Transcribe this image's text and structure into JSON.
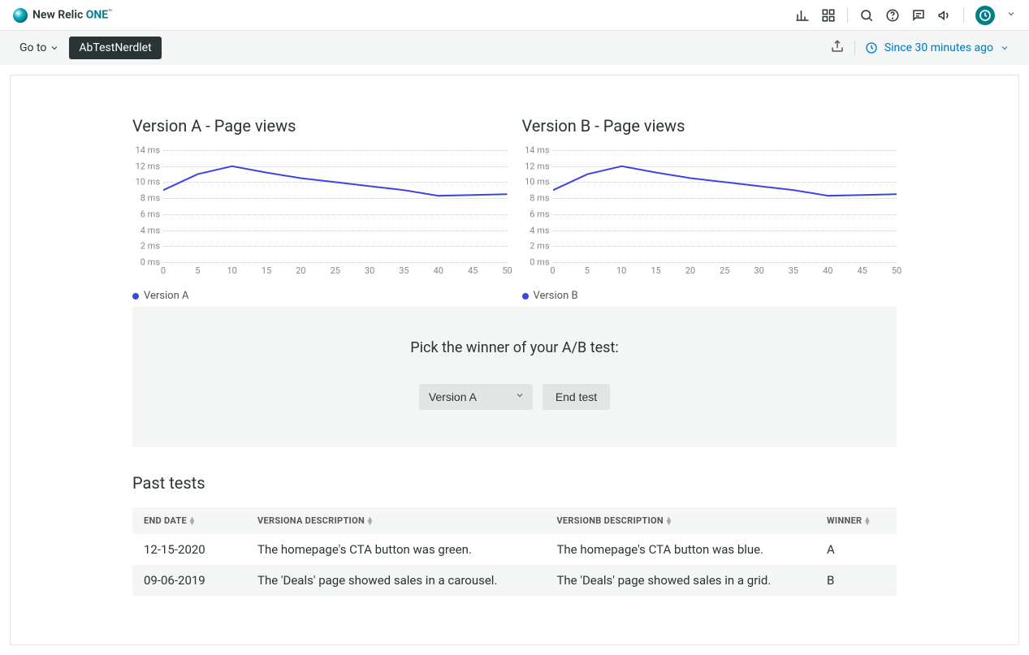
{
  "brand": {
    "name": "New Relic",
    "suffix": "ONE",
    "tm": "™"
  },
  "subheader": {
    "goto": "Go to",
    "chip": "AbTestNerdlet",
    "time": "Since 30 minutes ago"
  },
  "charts": {
    "a": {
      "title": "Version A - Page views",
      "legend": "Version A"
    },
    "b": {
      "title": "Version B - Page views",
      "legend": "Version B"
    }
  },
  "chart_data": [
    {
      "type": "line",
      "title": "Version A - Page views",
      "xlabel": "",
      "ylabel": "",
      "x": [
        0,
        5,
        10,
        15,
        20,
        25,
        30,
        35,
        40,
        45,
        50
      ],
      "y_ticks": [
        "0 ms",
        "2 ms",
        "4 ms",
        "6 ms",
        "8 ms",
        "10 ms",
        "12 ms",
        "14 ms"
      ],
      "ylim": [
        0,
        14
      ],
      "series": [
        {
          "name": "Version A",
          "values": [
            9,
            11,
            12,
            11.2,
            10.5,
            10,
            9.5,
            9,
            8.3,
            8.4,
            8.5
          ],
          "color": "#3b46e0"
        }
      ]
    },
    {
      "type": "line",
      "title": "Version B - Page views",
      "xlabel": "",
      "ylabel": "",
      "x": [
        0,
        5,
        10,
        15,
        20,
        25,
        30,
        35,
        40,
        45,
        50
      ],
      "y_ticks": [
        "0 ms",
        "2 ms",
        "4 ms",
        "6 ms",
        "8 ms",
        "10 ms",
        "12 ms",
        "14 ms"
      ],
      "ylim": [
        0,
        14
      ],
      "series": [
        {
          "name": "Version B",
          "values": [
            9,
            11,
            12,
            11.2,
            10.5,
            10,
            9.5,
            9,
            8.3,
            8.4,
            8.5
          ],
          "color": "#3b46e0"
        }
      ]
    }
  ],
  "winner": {
    "title": "Pick the winner of your A/B test:",
    "selected": "Version A",
    "button": "End test"
  },
  "past": {
    "title": "Past tests",
    "headers": {
      "end_date": "END DATE",
      "va_desc": "VERSIONA DESCRIPTION",
      "vb_desc": "VERSIONB DESCRIPTION",
      "winner": "WINNER"
    },
    "rows": [
      {
        "end_date": "12-15-2020",
        "va": "The homepage's CTA button was green.",
        "vb": "The homepage's CTA button was blue.",
        "winner": "A"
      },
      {
        "end_date": "09-06-2019",
        "va": "The 'Deals' page showed sales in a carousel.",
        "vb": "The 'Deals' page showed sales in a grid.",
        "winner": "B"
      }
    ]
  }
}
